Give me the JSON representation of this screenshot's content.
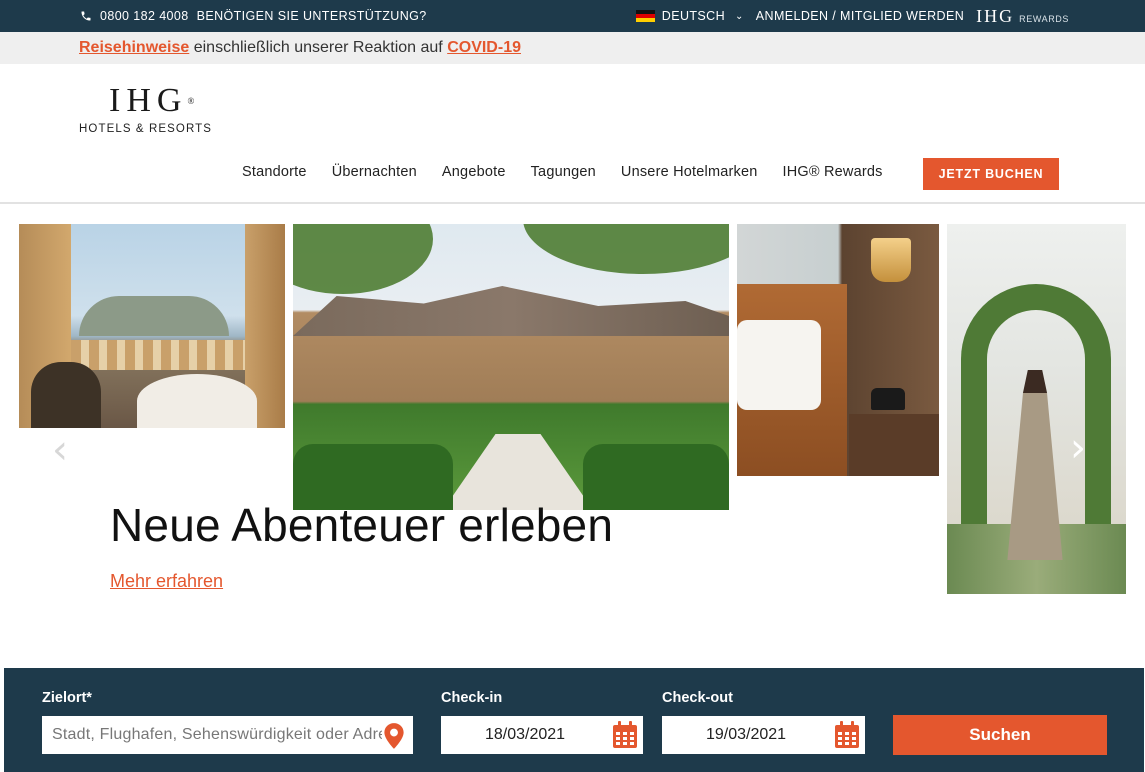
{
  "topbar": {
    "phone": "0800 182 4008",
    "support": "BENÖTIGEN SIE UNTERSTÜTZUNG?",
    "language": "DEUTSCH",
    "login": "ANMELDEN / MITGLIED WERDEN",
    "rewards_brand": "IHG",
    "rewards_label": "REWARDS"
  },
  "notice": {
    "link1": "Reisehinweise",
    "text": " einschließlich unserer Reaktion auf ",
    "link2": "COVID-19"
  },
  "logo": {
    "mark": "IHG",
    "registered": "®",
    "subtitle": "HOTELS & RESORTS"
  },
  "nav": {
    "items": [
      "Standorte",
      "Übernachten",
      "Angebote",
      "Tagungen",
      "Unsere Hotelmarken",
      "IHG® Rewards"
    ],
    "book_label": "JETZT BUCHEN"
  },
  "hero": {
    "title": "Neue Abenteuer erleben",
    "link": "Mehr erfahren"
  },
  "search": {
    "destination_label": "Zielort*",
    "destination_placeholder": "Stadt, Flughafen, Sehenswürdigkeit oder Adresse",
    "checkin_label": "Check-in",
    "checkin_value": "18/03/2021",
    "checkout_label": "Check-out",
    "checkout_value": "19/03/2021",
    "submit_label": "Suchen"
  },
  "colors": {
    "navy": "#1e3a4b",
    "accent": "#e4572e",
    "notice_bg": "#efefef"
  },
  "icons": [
    "phone-icon",
    "flag-de-icon",
    "chevron-down-icon",
    "map-pin-icon",
    "calendar-icon",
    "arrow-left-icon",
    "arrow-right-icon"
  ]
}
